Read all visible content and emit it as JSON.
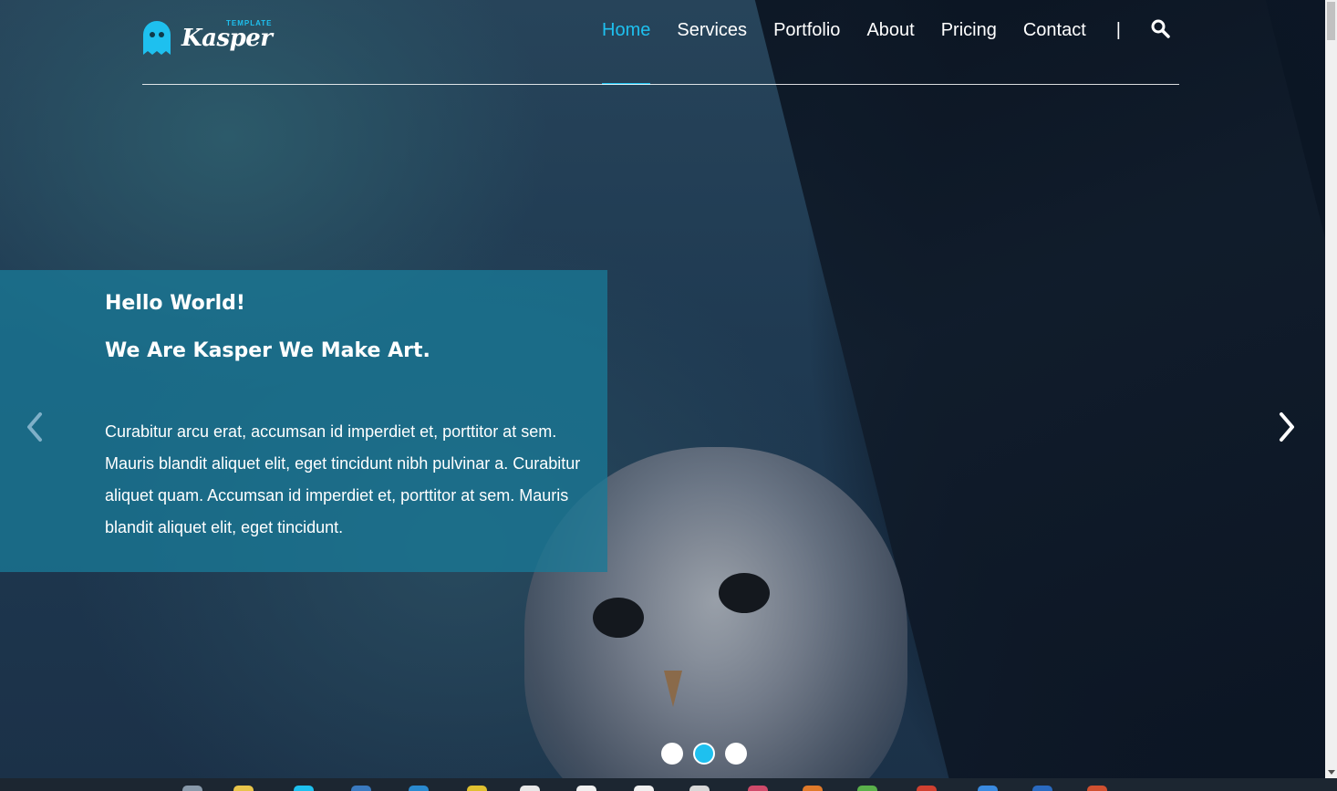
{
  "logo": {
    "brand": "Kasper",
    "sub": "TEMPLATE",
    "icon": "ghost-icon"
  },
  "nav": {
    "items": [
      "Home",
      "Services",
      "Portfolio",
      "About",
      "Pricing",
      "Contact"
    ],
    "active": "Home",
    "separator": "|",
    "search_icon": "search-icon"
  },
  "slide": {
    "greeting": "Hello World!",
    "headline": "We Are Kasper We Make Art.",
    "body": "Curabitur arcu erat, accumsan id imperdiet et, porttitor at sem. Mauris blandit aliquet elit, eget tincidunt nibh pulvinar a. Curabitur aliquet quam. Accumsan id imperdiet et, porttitor at sem. Mauris blandit aliquet elit, eget tincidunt."
  },
  "carousel": {
    "prev_icon": "chevron-left-icon",
    "next_icon": "chevron-right-icon",
    "dots": 3,
    "active_dot": 1
  },
  "colors": {
    "accent": "#1ec0ef",
    "panel": "#1a7896",
    "text": "#ffffff"
  },
  "taskbar": {
    "icons": [
      "app-icon",
      "app-icon",
      "browser-icon",
      "app-icon",
      "browser-icon",
      "app-icon",
      "chrome-icon",
      "file-icon",
      "file-icon",
      "app-icon",
      "app-icon",
      "app-icon",
      "app-icon",
      "app-icon",
      "app-icon",
      "app-icon",
      "app-icon"
    ]
  }
}
